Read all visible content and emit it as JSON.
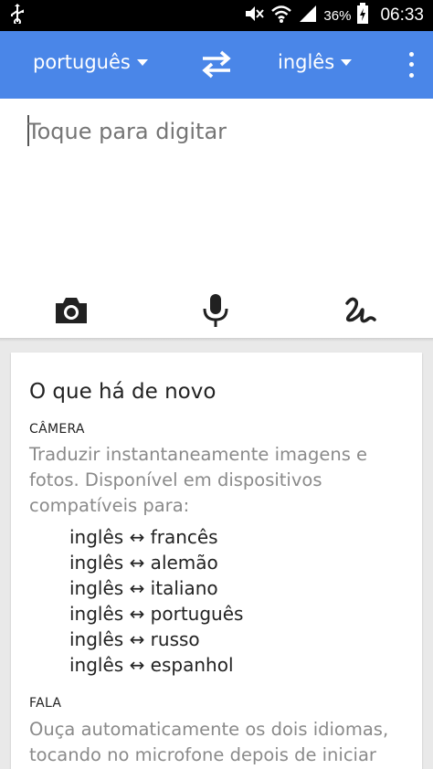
{
  "status_bar": {
    "battery_percent": "36%",
    "time": "06:33"
  },
  "app_bar": {
    "source_language": "português",
    "target_language": "inglês"
  },
  "input": {
    "placeholder": "Toque para digitar"
  },
  "whats_new": {
    "title": "O que há de novo",
    "camera_label": "CÂMERA",
    "camera_description": "Traduzir instantaneamente imagens e fotos. Disponível em dispositivos compatíveis para:",
    "camera_pairs": [
      "inglês ↔ francês",
      "inglês ↔ alemão",
      "inglês ↔ italiano",
      "inglês ↔ português",
      "inglês ↔ russo",
      "inglês ↔ espanhol"
    ],
    "speech_label": "FALA",
    "speech_description": "Ouça automaticamente os dois idiomas, tocando no microfone depois de iniciar"
  },
  "colors": {
    "app_bar": "#4a86e8",
    "status_bar": "#000000",
    "secondary_text": "#8a8a8a"
  },
  "icons": [
    "usb-icon",
    "mute-icon",
    "wifi-icon",
    "signal-icon",
    "battery-charging-icon",
    "swap-icon",
    "overflow-menu-icon",
    "camera-icon",
    "microphone-icon",
    "handwriting-icon"
  ]
}
